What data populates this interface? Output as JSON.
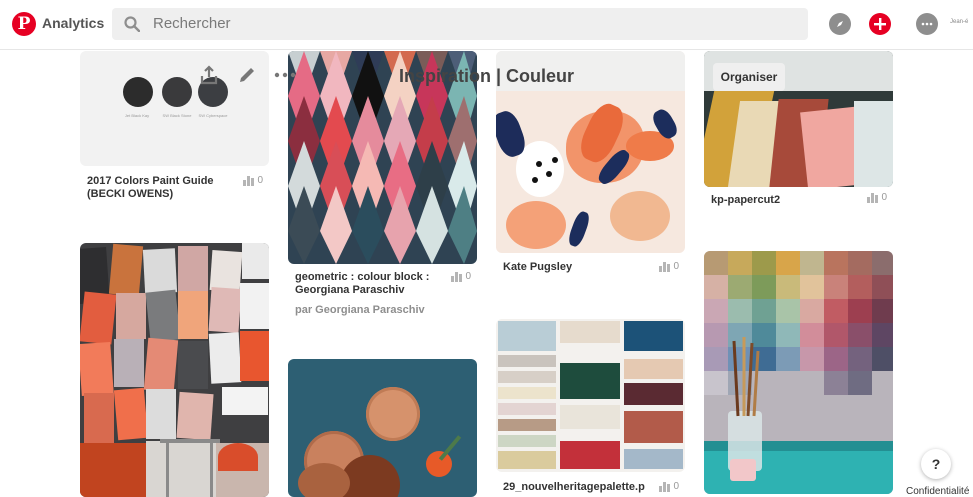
{
  "topbar": {
    "logo": "P",
    "analytics_label": "Analytics",
    "search_placeholder": "Rechercher",
    "avatar_label": "Jean-é"
  },
  "board": {
    "title": "Inspiration | Couleur",
    "organise_label": "Organiser"
  },
  "pins": [
    {
      "caption": "2017 Colors Paint Guide (BECKI OWENS)",
      "saves": "0",
      "swatch_labels": [
        "Jet Black Kay",
        "SW Black Stone",
        "SW Cyberspace"
      ]
    },
    {
      "caption": "geometric : colour block : Georgiana Paraschiv",
      "saves": "0",
      "by": "par Georgiana Paraschiv"
    },
    {
      "caption": "Kate Pugsley",
      "saves": "0"
    },
    {
      "caption": "kp-papercut2",
      "saves": "0"
    },
    {
      "caption": "",
      "saves": ""
    },
    {
      "caption": "",
      "saves": ""
    },
    {
      "caption": "29_nouvelheritagepalette.p",
      "saves": "0"
    },
    {
      "caption": "",
      "saves": ""
    }
  ],
  "footer": {
    "help": "?",
    "privacy": "Confidentialité"
  },
  "colors": {
    "brand": "#e60023"
  }
}
